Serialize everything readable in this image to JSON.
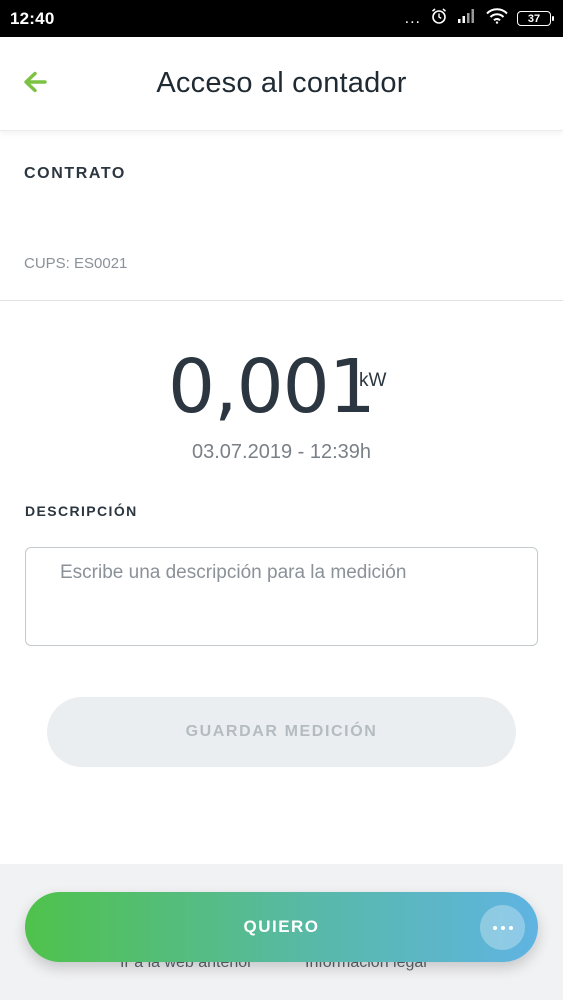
{
  "status_bar": {
    "time": "12:40",
    "dots": "...",
    "battery": "37",
    "icons": [
      "alarm-icon",
      "signal-icon",
      "wifi-icon",
      "battery-icon"
    ]
  },
  "header": {
    "title": "Acceso al contador",
    "back_icon": "arrow-left-icon",
    "accent_color": "#7cc242"
  },
  "contract": {
    "label": "CONTRATO",
    "cups": "CUPS: ES0021"
  },
  "reading": {
    "value": "0,001",
    "unit": "kW",
    "datetime": "03.07.2019 - 12:39h"
  },
  "description": {
    "label": "DESCRIPCIÓN",
    "value": "",
    "placeholder": "Escribe una descripción para la medición"
  },
  "save_button": {
    "label": "GUARDAR MEDICIÓN",
    "enabled": false
  },
  "footer": {
    "link_web": "Ir a la web anterior",
    "link_legal": "Información legal"
  },
  "action_bar": {
    "label": "QUIERO",
    "more_icon": "more-horizontal-icon",
    "gradient_start": "#4fc24b",
    "gradient_end": "#5fb4e2"
  }
}
